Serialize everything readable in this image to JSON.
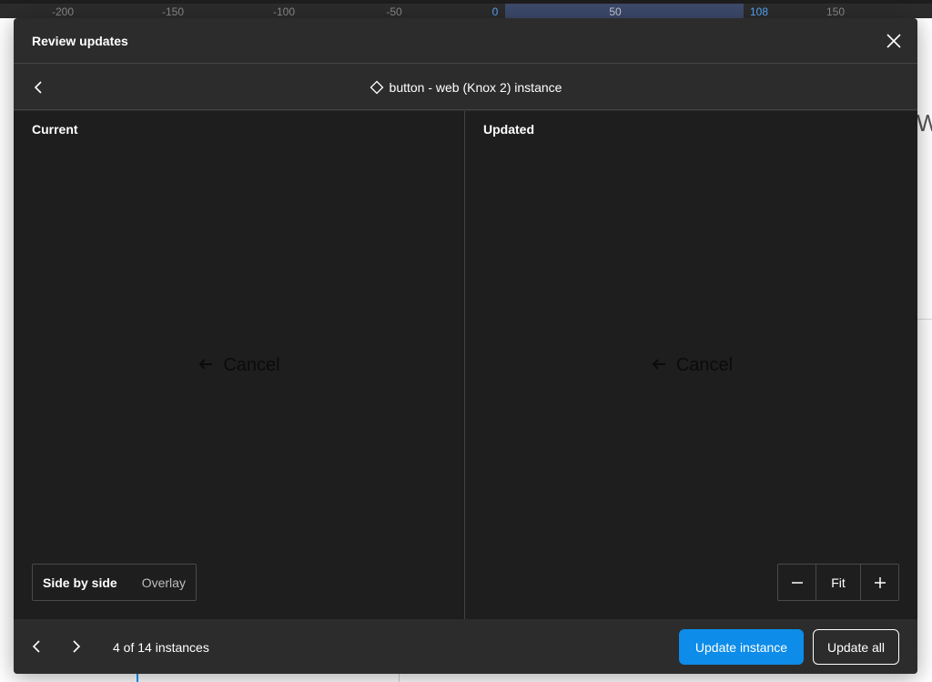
{
  "ruler": {
    "ticks": [
      "-200",
      "-150",
      "-100",
      "-50",
      "0",
      "50",
      "108",
      "150"
    ]
  },
  "modal": {
    "title": "Review updates",
    "component_name": "button - web (Knox 2) instance",
    "panes": {
      "current_label": "Current",
      "updated_label": "Updated",
      "current_preview_text": "Cancel",
      "updated_preview_text": "Cancel"
    },
    "view_toggle": {
      "options": [
        "Side by side",
        "Overlay"
      ],
      "selected": "Side by side"
    },
    "zoom": {
      "fit_label": "Fit"
    },
    "footer": {
      "count_text": "4 of 14 instances",
      "update_instance_label": "Update instance",
      "update_all_label": "Update all"
    }
  },
  "icons": {
    "close": "close-icon",
    "back": "chevron-left-icon",
    "component": "component-diamond-icon",
    "prev": "chevron-left-icon",
    "next": "chevron-right-icon",
    "zoom_out": "minus-icon",
    "zoom_in": "plus-icon",
    "preview_arrow": "arrow-left-icon"
  },
  "colors": {
    "modal_bg": "#2c2c2c",
    "canvas_bg": "#1e1e1e",
    "primary": "#0d8ce9",
    "accent_ruler": "#57a8ff"
  }
}
